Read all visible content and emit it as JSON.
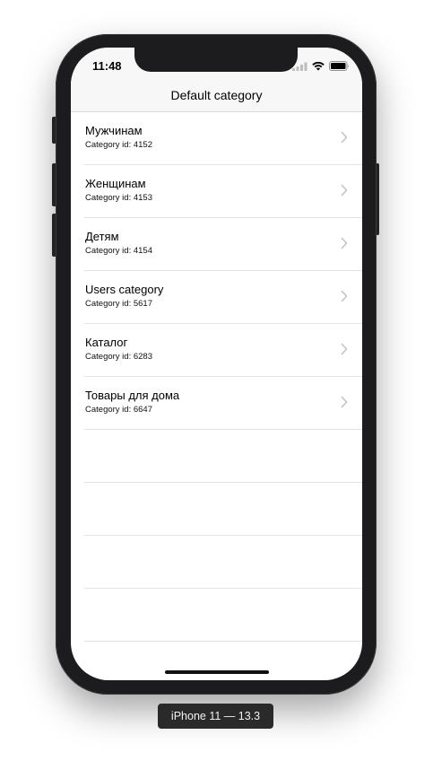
{
  "status_bar": {
    "time": "11:48"
  },
  "nav": {
    "title": "Default category"
  },
  "categories": [
    {
      "name": "Мужчинам",
      "subtitle": "Category id: 4152"
    },
    {
      "name": "Женщинам",
      "subtitle": "Category id: 4153"
    },
    {
      "name": "Детям",
      "subtitle": "Category id: 4154"
    },
    {
      "name": "Users category",
      "subtitle": "Category id: 5617"
    },
    {
      "name": "Каталог",
      "subtitle": "Category id: 6283"
    },
    {
      "name": "Товары для дома",
      "subtitle": "Category id: 6647"
    }
  ],
  "simulator": {
    "device_label": "iPhone 11 — 13.3"
  },
  "icons": {
    "row_accessory": "chevron-right-icon",
    "signal": "cellular-signal-icon",
    "wifi": "wifi-icon",
    "battery": "battery-icon"
  },
  "colors": {
    "bar_background": "#f7f7f7",
    "separator": "#e3e3e3",
    "chevron": "#c4c4c7",
    "device_frame": "#1c1c1e"
  }
}
